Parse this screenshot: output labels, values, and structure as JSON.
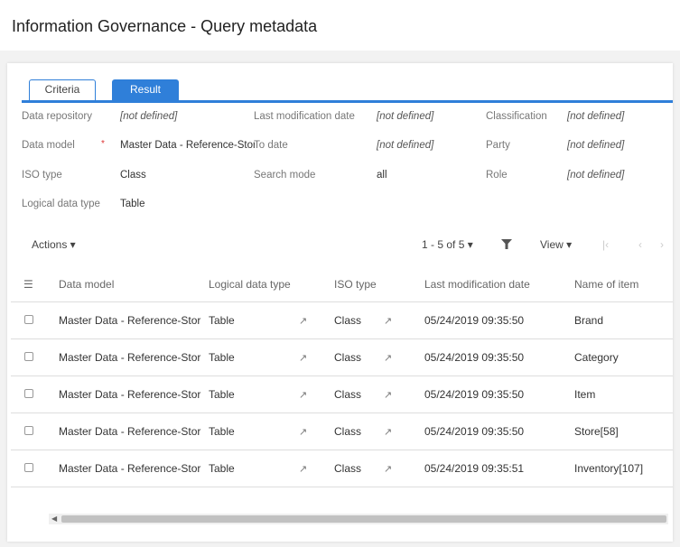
{
  "header": {
    "title": "Information Governance - Query metadata"
  },
  "tabs": [
    {
      "label": "Criteria"
    },
    {
      "label": "Result"
    }
  ],
  "criteria": {
    "data_repository": {
      "label": "Data repository",
      "value": "[not defined]"
    },
    "data_model": {
      "label": "Data model",
      "required": "*",
      "value": "Master Data - Reference-Stor"
    },
    "iso_type": {
      "label": "ISO type",
      "value": "Class"
    },
    "logical_data_type": {
      "label": "Logical data type",
      "value": "Table"
    },
    "last_mod_date": {
      "label": "Last modification date",
      "value": "[not defined]"
    },
    "to_date": {
      "label": "To date",
      "value": "[not defined]"
    },
    "search_mode": {
      "label": "Search mode",
      "value": "all"
    },
    "classification": {
      "label": "Classification",
      "value": "[not defined]"
    },
    "party": {
      "label": "Party",
      "value": "[not defined]"
    },
    "role": {
      "label": "Role",
      "value": "[not defined]"
    }
  },
  "toolbar": {
    "actions": "Actions ▾",
    "pagination": "1 - 5 of 5 ▾",
    "view": "View ▾",
    "first": "|‹",
    "prev": "‹",
    "next": "›"
  },
  "table": {
    "columns": [
      "Data model",
      "Logical data type",
      "ISO type",
      "Last modification date",
      "Name of item"
    ],
    "rows": [
      {
        "data_model": "Master Data - Reference-Stor",
        "logical": "Table",
        "iso": "Class",
        "date": "05/24/2019 09:35:50",
        "name": "Brand"
      },
      {
        "data_model": "Master Data - Reference-Stor",
        "logical": "Table",
        "iso": "Class",
        "date": "05/24/2019 09:35:50",
        "name": "Category"
      },
      {
        "data_model": "Master Data - Reference-Stor",
        "logical": "Table",
        "iso": "Class",
        "date": "05/24/2019 09:35:50",
        "name": "Item"
      },
      {
        "data_model": "Master Data - Reference-Stor",
        "logical": "Table",
        "iso": "Class",
        "date": "05/24/2019 09:35:50",
        "name": "Store[58]"
      },
      {
        "data_model": "Master Data - Reference-Stor",
        "logical": "Table",
        "iso": "Class",
        "date": "05/24/2019 09:35:51",
        "name": "Inventory[107]"
      }
    ]
  }
}
